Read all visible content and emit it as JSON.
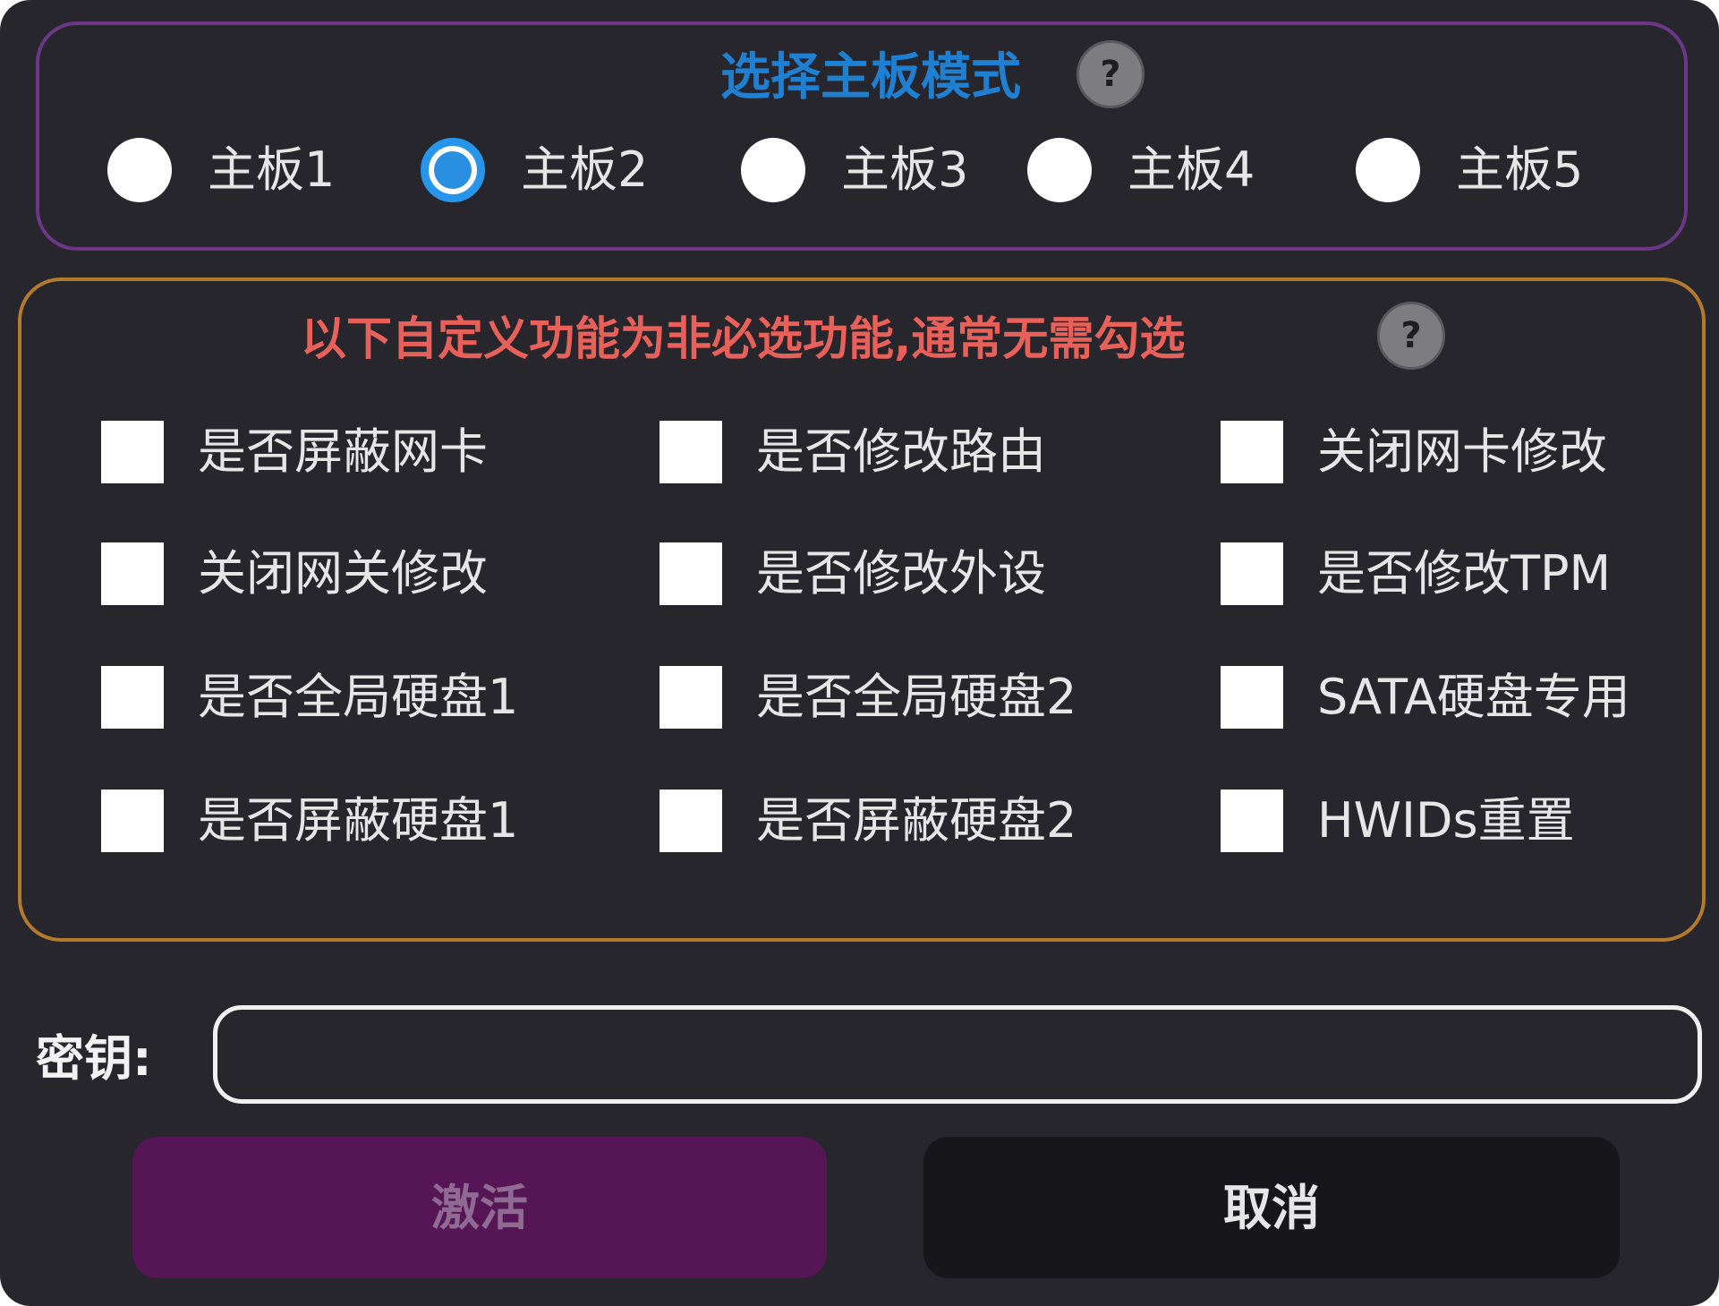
{
  "board_section": {
    "title": "选择主板模式",
    "help_label": "?",
    "options": [
      {
        "label": "主板1",
        "checked": false
      },
      {
        "label": "主板2",
        "checked": true
      },
      {
        "label": "主板3",
        "checked": false
      },
      {
        "label": "主板4",
        "checked": false
      },
      {
        "label": "主板5",
        "checked": false
      }
    ]
  },
  "features_section": {
    "title": "以下自定义功能为非必选功能,通常无需勾选",
    "help_label": "?",
    "items": [
      {
        "label": "是否屏蔽网卡",
        "checked": false
      },
      {
        "label": "是否修改路由",
        "checked": false
      },
      {
        "label": "关闭网卡修改",
        "checked": false
      },
      {
        "label": "关闭网关修改",
        "checked": false
      },
      {
        "label": "是否修改外设",
        "checked": false
      },
      {
        "label": "是否修改TPM",
        "checked": false
      },
      {
        "label": "是否全局硬盘1",
        "checked": false
      },
      {
        "label": "是否全局硬盘2",
        "checked": false
      },
      {
        "label": "SATA硬盘专用",
        "checked": false
      },
      {
        "label": "是否屏蔽硬盘1",
        "checked": false
      },
      {
        "label": "是否屏蔽硬盘2",
        "checked": false
      },
      {
        "label": "HWIDs重置",
        "checked": false
      }
    ]
  },
  "key": {
    "label": "密钥:",
    "value": "",
    "placeholder": ""
  },
  "buttons": {
    "activate": "激活",
    "cancel": "取消"
  },
  "colors": {
    "background": "#27262d",
    "board_title": "#1f7fd1",
    "board_border": "#6b3786",
    "features_title": "#e8605a",
    "features_border": "#b37a2c",
    "radio_selected": "#2795ea",
    "activate_button": "#561656",
    "cancel_button": "#17161a"
  }
}
